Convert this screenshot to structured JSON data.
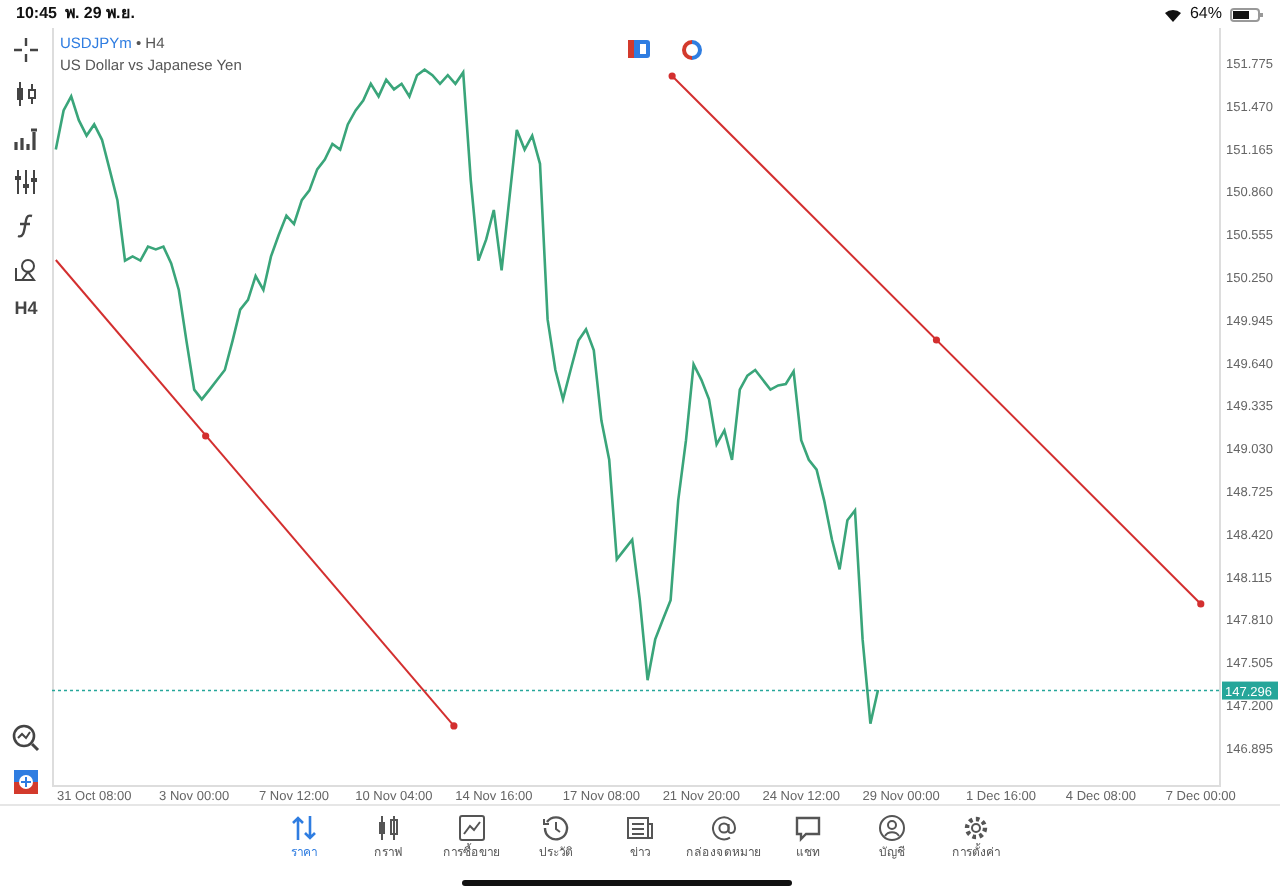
{
  "status_bar": {
    "time": "10:45",
    "date": "พ. 29 พ.ย.",
    "battery": "64%"
  },
  "toolbar": {
    "timeframe": "H4"
  },
  "chart": {
    "separator": "•",
    "timeframe": "H4",
    "description": "US Dollar vs Japanese Yen",
    "chart_data": {
      "type": "line",
      "ylim": [
        146.616,
        152.017
      ],
      "categories": [
        null,
        null,
        null,
        null,
        null,
        "31 Oct 08:00",
        null,
        null,
        null,
        null,
        null,
        null,
        null,
        null,
        null,
        null,
        null,
        null,
        "3 Nov 00:00",
        null,
        null,
        null,
        null,
        null,
        null,
        null,
        null,
        null,
        null,
        null,
        null,
        "7 Nov 12:00",
        null,
        null,
        null,
        null,
        null,
        null,
        null,
        null,
        null,
        null,
        null,
        null,
        "10 Nov 04:00",
        null,
        null,
        null,
        null,
        null,
        null,
        null,
        null,
        null,
        null,
        null,
        null,
        "14 Nov 16:00",
        null,
        null,
        null,
        null,
        null,
        null,
        null,
        null,
        null,
        null,
        null,
        null,
        null,
        "17 Nov 08:00",
        null,
        null,
        null,
        null,
        null,
        null,
        null,
        null,
        null,
        null,
        null,
        null,
        "21 Nov 20:00",
        null,
        null,
        null,
        null,
        null,
        null,
        null,
        null,
        null,
        null,
        null,
        null,
        "24 Nov 12:00",
        null,
        null,
        null,
        null,
        null,
        null,
        null,
        null,
        null,
        null,
        null,
        null,
        "29 Nov 00:00",
        null,
        null,
        null,
        null,
        null,
        null,
        null,
        null,
        null,
        null,
        null,
        null,
        "1 Dec 16:00",
        null,
        null,
        null,
        null,
        null,
        null,
        null,
        null,
        null,
        null,
        null,
        null,
        "4 Dec 08:00",
        null,
        null,
        null,
        null,
        null,
        null,
        null,
        null,
        null,
        null,
        null,
        null,
        "7 Dec 00:00",
        null,
        null
      ],
      "series": [
        {
          "name": "USDJPYm",
          "color": "#3aa57a",
          "values": [
            151.15,
            151.43,
            151.53,
            151.36,
            151.25,
            151.33,
            151.22,
            151.01,
            150.79,
            150.36,
            150.39,
            150.36,
            150.46,
            150.44,
            150.46,
            150.34,
            150.15,
            149.79,
            149.44,
            149.37,
            149.44,
            149.51,
            149.58,
            149.79,
            150.01,
            150.08,
            150.25,
            150.15,
            150.39,
            150.54,
            150.68,
            150.62,
            150.79,
            150.86,
            151.01,
            151.08,
            151.19,
            151.15,
            151.33,
            151.43,
            151.5,
            151.62,
            151.53,
            151.65,
            151.58,
            151.62,
            151.53,
            151.68,
            151.72,
            151.68,
            151.62,
            151.68,
            151.62,
            151.7,
            150.93,
            150.36,
            150.51,
            150.72,
            150.29,
            150.79,
            151.29,
            151.15,
            151.25,
            151.05,
            149.94,
            149.58,
            149.37,
            149.58,
            149.79,
            149.87,
            149.72,
            149.22,
            148.94,
            148.23,
            148.3,
            148.37,
            147.94,
            147.37,
            147.66,
            147.8,
            147.94,
            148.65,
            149.08,
            149.62,
            149.51,
            149.37,
            149.05,
            149.15,
            148.94,
            149.44,
            149.54,
            149.58,
            149.51,
            149.44,
            149.47,
            149.48,
            149.57,
            149.08,
            148.94,
            148.87,
            148.65,
            148.37,
            148.16,
            148.51,
            148.58,
            147.66,
            147.06,
            147.3,
            null,
            null,
            null,
            null,
            null,
            null,
            null,
            null,
            null,
            null,
            null,
            null,
            null,
            null,
            null,
            null,
            null,
            null,
            null,
            null,
            null,
            null,
            null,
            null,
            null,
            null,
            null,
            null,
            null,
            null,
            null,
            null,
            null,
            null,
            null,
            null,
            null,
            null,
            null,
            null,
            null,
            null,
            null,
            null
          ]
        }
      ],
      "yticks": [
        {
          "value": 151.775,
          "label": "151.775"
        },
        {
          "value": 151.47,
          "label": "151.470"
        },
        {
          "value": 151.165,
          "label": "151.165"
        },
        {
          "value": 150.86,
          "label": "150.860"
        },
        {
          "value": 150.555,
          "label": "150.555"
        },
        {
          "value": 150.25,
          "label": "150.250"
        },
        {
          "value": 149.945,
          "label": "149.945"
        },
        {
          "value": 149.64,
          "label": "149.640"
        },
        {
          "value": 149.335,
          "label": "149.335"
        },
        {
          "value": 149.03,
          "label": "149.030"
        },
        {
          "value": 148.725,
          "label": "148.725"
        },
        {
          "value": 148.42,
          "label": "148.420"
        },
        {
          "value": 148.115,
          "label": "148.115"
        },
        {
          "value": 147.81,
          "label": "147.810"
        },
        {
          "value": 147.505,
          "label": "147.505"
        },
        {
          "value": 147.2,
          "label": "147.200"
        },
        {
          "value": 146.895,
          "label": "146.895"
        }
      ],
      "ref_lines": [
        {
          "axis": "y",
          "value": 147.296,
          "label": "147.296"
        }
      ]
    }
  },
  "tabs": [
    {
      "label": "ราคา",
      "selected": true
    },
    {
      "label": "กราฟ",
      "selected": false
    },
    {
      "label": "การซื้อขาย",
      "selected": false
    },
    {
      "label": "ประวัติ",
      "selected": false
    },
    {
      "label": "ข่าว",
      "selected": false
    },
    {
      "label": "กล่องจดหมาย",
      "selected": false
    },
    {
      "label": "แชท",
      "selected": false
    },
    {
      "label": "บัญชี",
      "selected": false
    },
    {
      "label": "การตั้งค่า",
      "selected": false
    }
  ]
}
